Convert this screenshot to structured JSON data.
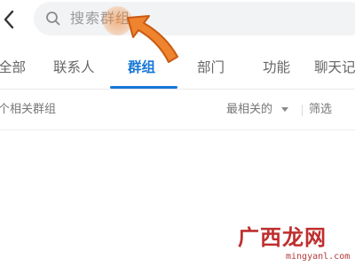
{
  "header": {
    "back_icon": "chevron-left-icon",
    "search_icon": "search-icon",
    "search_placeholder": "搜索群组"
  },
  "tabs": [
    {
      "label": "全部",
      "active": false
    },
    {
      "label": "联系人",
      "active": false
    },
    {
      "label": "群组",
      "active": true
    },
    {
      "label": "部门",
      "active": false
    },
    {
      "label": "功能",
      "active": false
    },
    {
      "label": "聊天记",
      "active": false
    }
  ],
  "results": {
    "count_text": "个相关群组",
    "sort_label": "最相关的",
    "filter_label": "筛选"
  },
  "overlay": {
    "pointer_icon": "curved-arrow-icon",
    "highlight_color": "#f08a3a"
  },
  "watermark": {
    "logo_text": "广西龙网",
    "url_text": "mingyanl.com"
  },
  "colors": {
    "accent": "#1677d6",
    "search_bg": "#f2f3f5",
    "watermark": "#bf2f2f"
  }
}
